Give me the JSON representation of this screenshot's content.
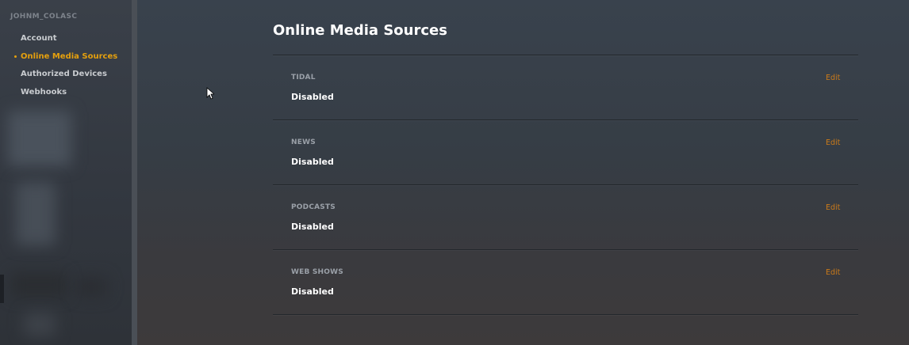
{
  "sidebar": {
    "username": "JOHNM_COLASC",
    "items": [
      {
        "label": "Account",
        "active": false
      },
      {
        "label": "Online Media Sources",
        "active": true
      },
      {
        "label": "Authorized Devices",
        "active": false
      },
      {
        "label": "Webhooks",
        "active": false
      }
    ]
  },
  "main": {
    "title": "Online Media Sources",
    "edit_label": "Edit",
    "sections": [
      {
        "name": "TIDAL",
        "status": "Disabled"
      },
      {
        "name": "NEWS",
        "status": "Disabled"
      },
      {
        "name": "PODCASTS",
        "status": "Disabled"
      },
      {
        "name": "WEB SHOWS",
        "status": "Disabled"
      }
    ]
  },
  "colors": {
    "accent": "#e5a00d",
    "edit_link": "#cc7b19",
    "background": "#39424d"
  }
}
